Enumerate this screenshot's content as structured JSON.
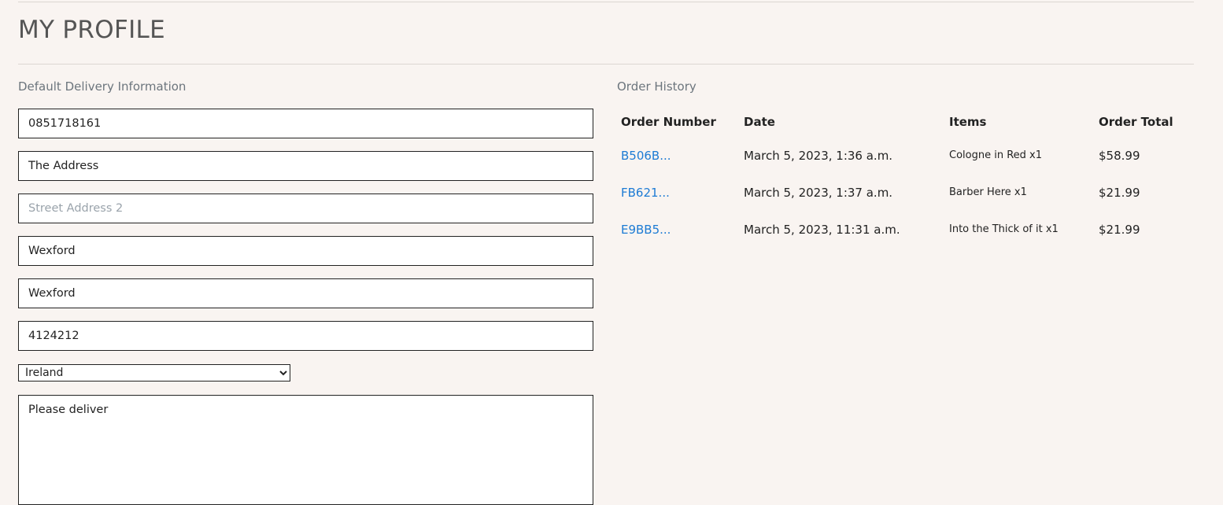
{
  "page": {
    "title": "MY PROFILE"
  },
  "delivery": {
    "heading": "Default Delivery Information",
    "phone_number": "0851718161",
    "street_address1": "The Address",
    "street_address2": "",
    "street_address2_placeholder": "Street Address 2",
    "town_or_city": "Wexford",
    "county": "Wexford",
    "postcode": "4124212",
    "country_selected": "Ireland",
    "notes": "Please deliver"
  },
  "orders": {
    "heading": "Order History",
    "columns": [
      "Order Number",
      "Date",
      "Items",
      "Order Total"
    ],
    "rows": [
      {
        "order_number": "B506B...",
        "date": "March 5, 2023, 1:36 a.m.",
        "items": "Cologne in Red x1",
        "total": "$58.99"
      },
      {
        "order_number": "FB621...",
        "date": "March 5, 2023, 1:37 a.m.",
        "items": "Barber Here x1",
        "total": "$21.99"
      },
      {
        "order_number": "E9BB5...",
        "date": "March 5, 2023, 11:31 a.m.",
        "items": "Into the Thick of it x1",
        "total": "$21.99"
      }
    ]
  },
  "colors": {
    "page_background": "#f9f4f1",
    "link": "#1d7bd4",
    "muted_heading": "#6c757d"
  }
}
